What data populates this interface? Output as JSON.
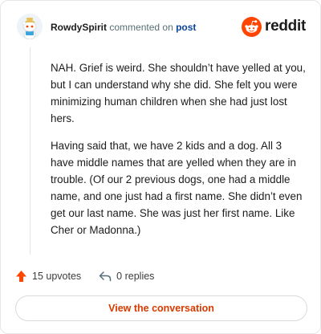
{
  "header": {
    "username": "RowdySpirit",
    "action_text": "commented on",
    "post_link": "post",
    "brand_name": "reddit",
    "brand_color": "#ff4500"
  },
  "comment": {
    "paragraphs": [
      "NAH. Grief is weird. She shouldn’t have yelled at you, but I can understand why she did. She felt you were minimizing human children when she had just lost hers.",
      "Having said that, we have 2 kids and a dog. All 3 have middle names that are yelled when they are in trouble. (Of our 2 previous dogs, one had a middle name, and one just had a first name. She didn’t even get our last name. She was just her first name. Like Cher or Madonna.)"
    ]
  },
  "actions": {
    "upvotes": "15 upvotes",
    "upvote_icon": "upvote-arrow-icon",
    "upvote_color": "#ff4500",
    "replies": "0 replies",
    "reply_icon": "reply-arrow-icon"
  },
  "cta": {
    "label": "View the conversation",
    "color": "#d93a00"
  }
}
